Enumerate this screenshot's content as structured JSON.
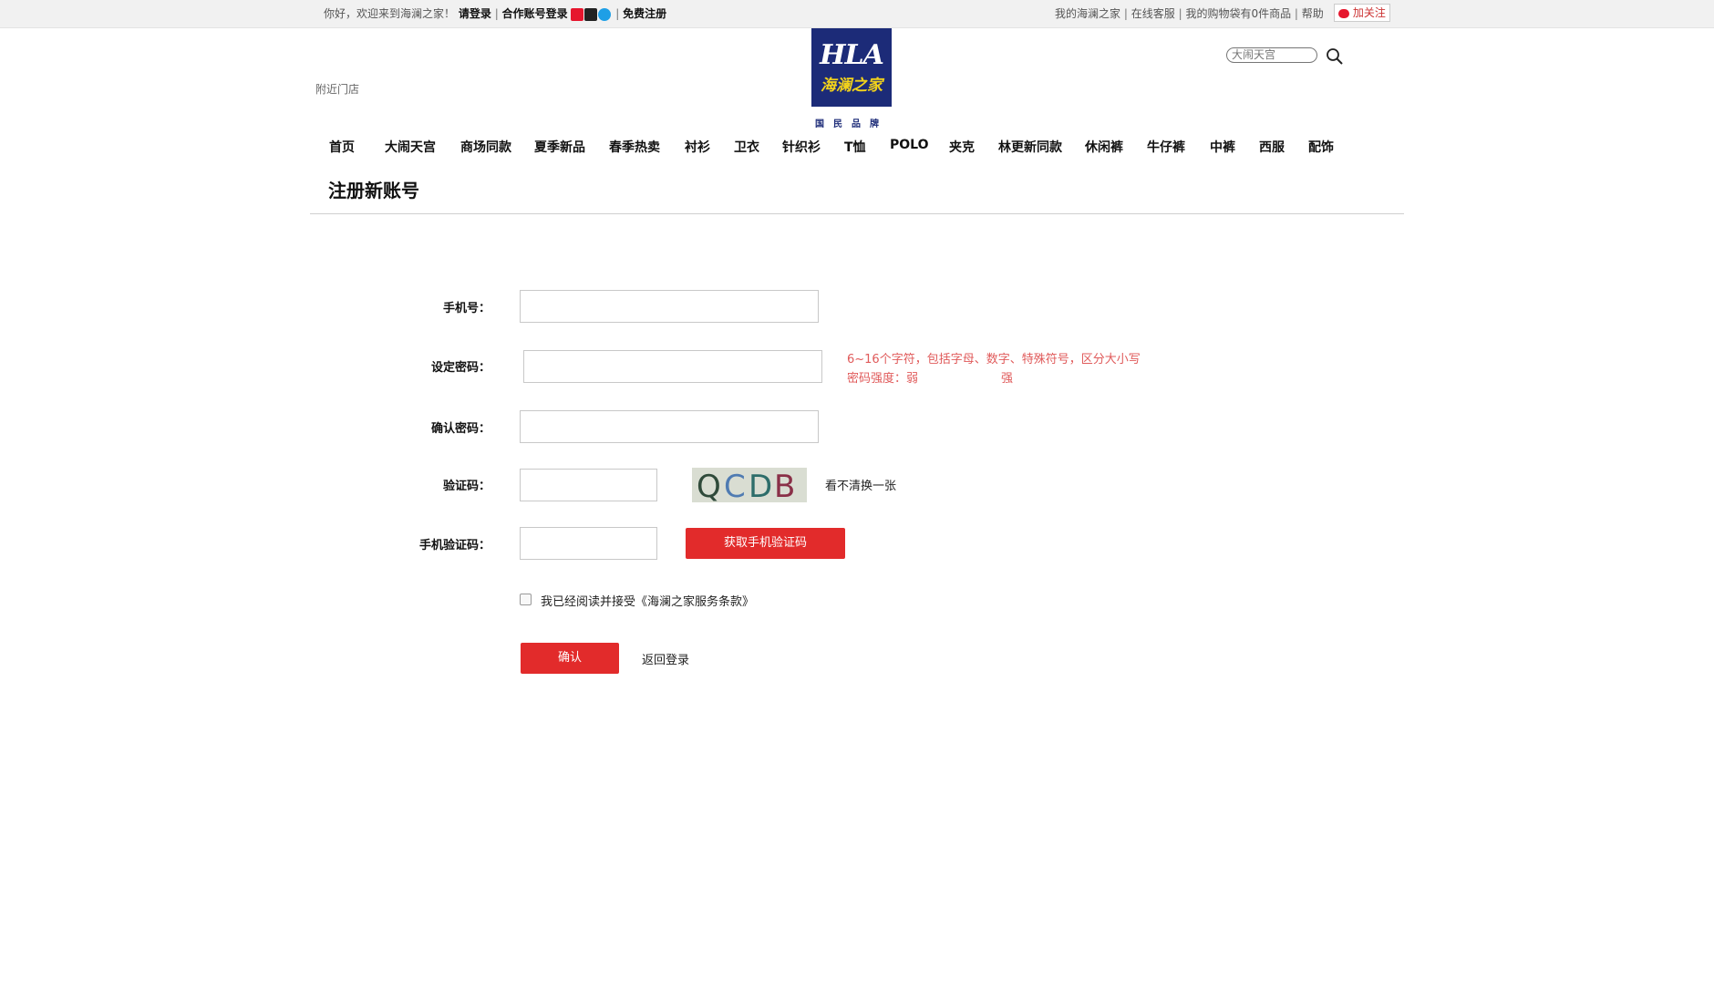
{
  "topbar": {
    "welcome": "你好，欢迎来到海澜之家！",
    "login": "请登录",
    "partner_login": "合作账号登录",
    "register": "免费注册",
    "separator": "|",
    "right_links": [
      "我的海澜之家",
      "在线客服",
      "我的购物袋有0件商品",
      "帮助"
    ],
    "follow": "加关注",
    "social_icons": [
      "weibo-icon",
      "qq-icon",
      "alipay-icon"
    ]
  },
  "header": {
    "nearby_stores": "附近门店",
    "logo_en": "HLA",
    "logo_cn": "海澜之家",
    "logo_sub": "国民品牌",
    "search_placeholder": "大闹天宫"
  },
  "nav": [
    "首页",
    "大闹天宫",
    "商场同款",
    "夏季新品",
    "春季热卖",
    "衬衫",
    "卫衣",
    "针织衫",
    "T恤",
    "POLO",
    "夹克",
    "林更新同款",
    "休闲裤",
    "牛仔裤",
    "中裤",
    "西服",
    "配饰"
  ],
  "page_title": "注册新账号",
  "form": {
    "phone_label": "手机号：",
    "password_label": "设定密码：",
    "password_hint": "6~16个字符，包括字母、数字、特殊符号，区分大小写",
    "strength_label": "密码强度：弱",
    "strength_strong": "强",
    "confirm_label": "确认密码：",
    "captcha_label": "验证码：",
    "captcha_text": [
      "Q",
      "C",
      "D",
      "B"
    ],
    "refresh_captcha": "看不清换一张",
    "sms_label": "手机验证码：",
    "get_sms_button": "获取手机验证码",
    "agree_text": "我已经阅读并接受《海澜之家服务条款》",
    "submit_button": "确认",
    "back_login": "返回登录"
  },
  "colors": {
    "accent_red": "#e22b2b",
    "hint_red": "#e05a5a",
    "logo_blue": "#1c2b78",
    "logo_yellow": "#f2d21b"
  }
}
